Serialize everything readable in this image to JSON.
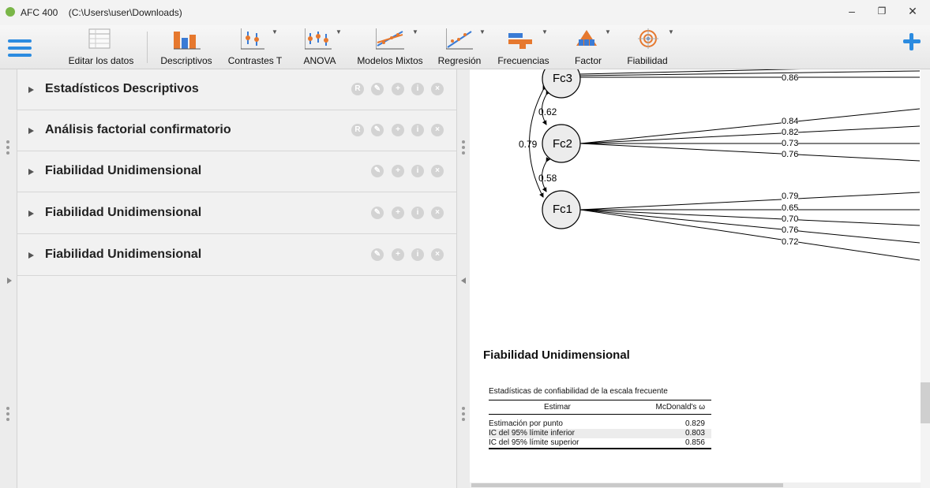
{
  "window": {
    "title": "AFC 400",
    "path": "(C:\\Users\\user\\Downloads)",
    "minimize": "–",
    "restore": "❐",
    "close": "✕"
  },
  "ribbon": {
    "edit_data": "Editar los datos",
    "descriptives": "Descriptivos",
    "t_tests": "Contrastes T",
    "anova": "ANOVA",
    "mixed_models": "Modelos Mixtos",
    "regression": "Regresión",
    "frequencies": "Frecuencias",
    "factor": "Factor",
    "reliability": "Fiabilidad"
  },
  "analyses": [
    {
      "title": "Estadísticos Descriptivos"
    },
    {
      "title": "Análisis factorial confirmatorio"
    },
    {
      "title": "Fiabilidad Unidimensional"
    },
    {
      "title": "Fiabilidad Unidimensional"
    },
    {
      "title": "Fiabilidad Unidimensional"
    }
  ],
  "diagram": {
    "factors": [
      "Fc3",
      "Fc2",
      "Fc1"
    ],
    "covariances": {
      "fc3_fc2": "0.62",
      "fc2_fc1": "0.58",
      "fc3_fc1": "0.79"
    },
    "fc3_loadings": [
      "0.86"
    ],
    "fc2_loadings": [
      "0.84",
      "0.82",
      "0.73",
      "0.76"
    ],
    "fc1_loadings": [
      "0.79",
      "0.65",
      "0.70",
      "0.76",
      "0.72"
    ]
  },
  "result": {
    "title": "Fiabilidad Unidimensional",
    "table_caption": "Estadísticas de confiabilidad de la escala frecuente",
    "col_estimate": "Estimar",
    "col_omega": "McDonald's ω",
    "rows": [
      {
        "label": "Estimación por punto",
        "value": "0.829"
      },
      {
        "label": "IC del 95% límite inferior",
        "value": "0.803"
      },
      {
        "label": "IC del 95% límite superior",
        "value": "0.856"
      }
    ]
  },
  "colors": {
    "accent": "#2b8be0",
    "ribbon_icon": "#e6782e",
    "ribbon_icon_alt": "#3a7bd5"
  }
}
